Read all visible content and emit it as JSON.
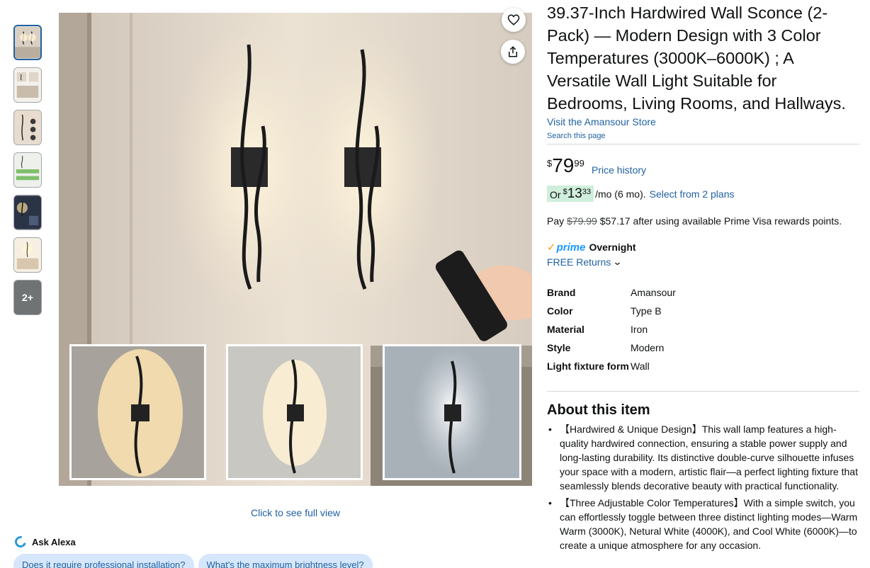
{
  "gallery": {
    "thumbnail_count": 7,
    "more_label": "2+",
    "full_view_label": "Click to see full view"
  },
  "product": {
    "title": "39.37-Inch Hardwired Wall Sconce (2-Pack) — Modern Design with 3 Color Temperatures (3000K–6000K) ; A Versatile Wall Light Suitable for Bedrooms, Living Rooms, and Hallways.",
    "store_link": "Visit the Amansour Store",
    "search_page": "Search this page"
  },
  "price": {
    "symbol": "$",
    "whole": "79",
    "fraction": "99",
    "history_link": "Price history"
  },
  "monthly": {
    "or_label": "Or",
    "symbol": "$",
    "whole": "13",
    "fraction": "33",
    "period": "/mo (6 mo).",
    "plans_link": "Select from 2 plans"
  },
  "rewards": {
    "pay_label": "Pay",
    "original": "$79.99",
    "text": "$57.17 after using available Prime Visa rewards points."
  },
  "delivery": {
    "prime_check": "✓",
    "prime_label": "prime",
    "speed": "Overnight",
    "returns": "FREE Returns"
  },
  "specs": [
    {
      "key": "Brand",
      "value": "Amansour"
    },
    {
      "key": "Color",
      "value": "Type B"
    },
    {
      "key": "Material",
      "value": "Iron"
    },
    {
      "key": "Style",
      "value": "Modern"
    },
    {
      "key": "Light fixture form",
      "value": "Wall"
    }
  ],
  "about": {
    "title": "About this item",
    "bullets": [
      "【Hardwired & Unique Design】This wall lamp features a high-quality hardwired connection, ensuring a stable power supply and long-lasting durability. Its distinctive double-curve silhouette infuses your space with a modern, artistic flair—a perfect lighting fixture that seamlessly blends decorative beauty with practical functionality.",
      "【Three Adjustable Color Temperatures】With a simple switch, you can effortlessly toggle between three distinct lighting modes—Warm Warm (3000K), Netural White (4000K), and Cool White (6000K)—to create a unique atmosphere for any occasion."
    ]
  },
  "alexa": {
    "label": "Ask Alexa",
    "questions": [
      "Does it require professional installation?",
      "What's the maximum brightness level?"
    ]
  },
  "colors": {
    "link": "#2162a1",
    "installment_badge": "#cfeedc",
    "prime_blue": "#1a98ff",
    "prime_orange": "#ff9900",
    "chip": "#d6e7fb"
  }
}
